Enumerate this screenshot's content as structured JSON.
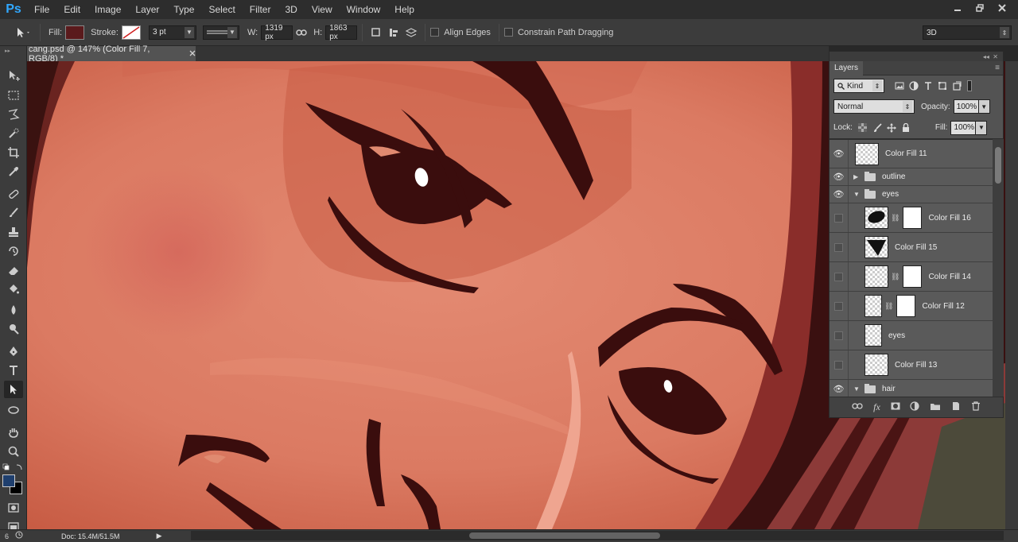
{
  "menubar": {
    "logo": "Ps",
    "items": [
      "File",
      "Edit",
      "Image",
      "Layer",
      "Type",
      "Select",
      "Filter",
      "3D",
      "View",
      "Window",
      "Help"
    ],
    "controls": [
      "minimize",
      "restore",
      "close"
    ]
  },
  "options": {
    "fill_label": "Fill:",
    "fill_color": "#5a1a1c",
    "stroke_label": "Stroke:",
    "stroke_width": "3 pt",
    "w_label": "W:",
    "w_value": "1319 px",
    "h_label": "H:",
    "h_value": "1863 px",
    "align_edges": "Align Edges",
    "constrain": "Constrain Path Dragging",
    "workspace": "3D"
  },
  "document": {
    "tab_title": "cang.psd @ 147% (Color Fill 7, RGB/8) *",
    "status": "Doc: 15.4M/51.5M"
  },
  "tools": {
    "foreground": "#1f3f6e",
    "background": "#000000"
  },
  "layers_panel": {
    "tab": "Layers",
    "filter_kind": "Kind",
    "blend_mode": "Normal",
    "opacity_label": "Opacity:",
    "opacity": "100%",
    "lock_label": "Lock:",
    "fill_label": "Fill:",
    "fill": "100%",
    "layers": [
      {
        "name": "Color Fill 11",
        "visible": true,
        "kind": "fill"
      },
      {
        "name": "outline",
        "visible": true,
        "kind": "group-collapsed"
      },
      {
        "name": "eyes",
        "visible": true,
        "kind": "group-open"
      },
      {
        "name": "Color Fill 16",
        "visible": false,
        "kind": "fill-mask"
      },
      {
        "name": "Color Fill 15",
        "visible": false,
        "kind": "fill"
      },
      {
        "name": "Color Fill 14",
        "visible": false,
        "kind": "fill-mask"
      },
      {
        "name": "Color Fill 12",
        "visible": false,
        "kind": "fill-mask"
      },
      {
        "name": "eyes",
        "visible": false,
        "kind": "pixel"
      },
      {
        "name": "Color Fill 13",
        "visible": false,
        "kind": "fill"
      },
      {
        "name": "hair",
        "visible": true,
        "kind": "group-open"
      }
    ]
  }
}
